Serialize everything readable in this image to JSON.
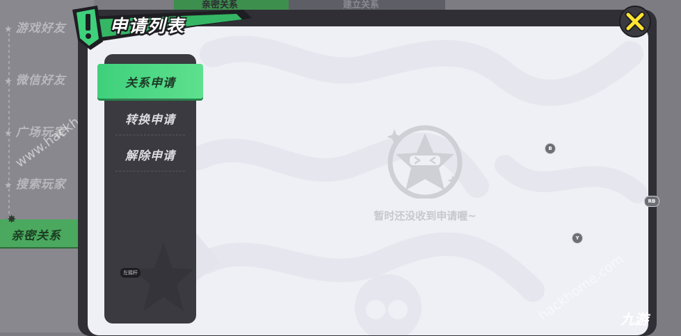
{
  "background_nav": {
    "items": [
      "游戏好友",
      "微信好友",
      "广场玩家",
      "搜索玩家"
    ],
    "active": "亲密关系",
    "tab_a": "亲密关系",
    "tab_b": "建立关系"
  },
  "dialog": {
    "title": "申请列表",
    "close_icon": "x-icon"
  },
  "side_menu": {
    "items": [
      {
        "label": "关系申请",
        "active": true
      },
      {
        "label": "转换申请",
        "active": false
      },
      {
        "label": "解除申请",
        "active": false
      }
    ],
    "stick_label": "左摇杆"
  },
  "empty_state": {
    "icon": "ninja-star-icon",
    "text": "暂时还没收到申请喔~"
  },
  "controller_badges": {
    "b": "B",
    "y": "Y",
    "rb": "RB"
  },
  "watermark": {
    "text_left": "www.hackhome.com",
    "text_right": "hackhome.com",
    "logo": "九游"
  },
  "colors": {
    "accent_green": "#3fd07c",
    "panel_dark": "#3a3a40",
    "dialog_bg": "#eff0f5",
    "close_yellow": "#ffe431"
  }
}
